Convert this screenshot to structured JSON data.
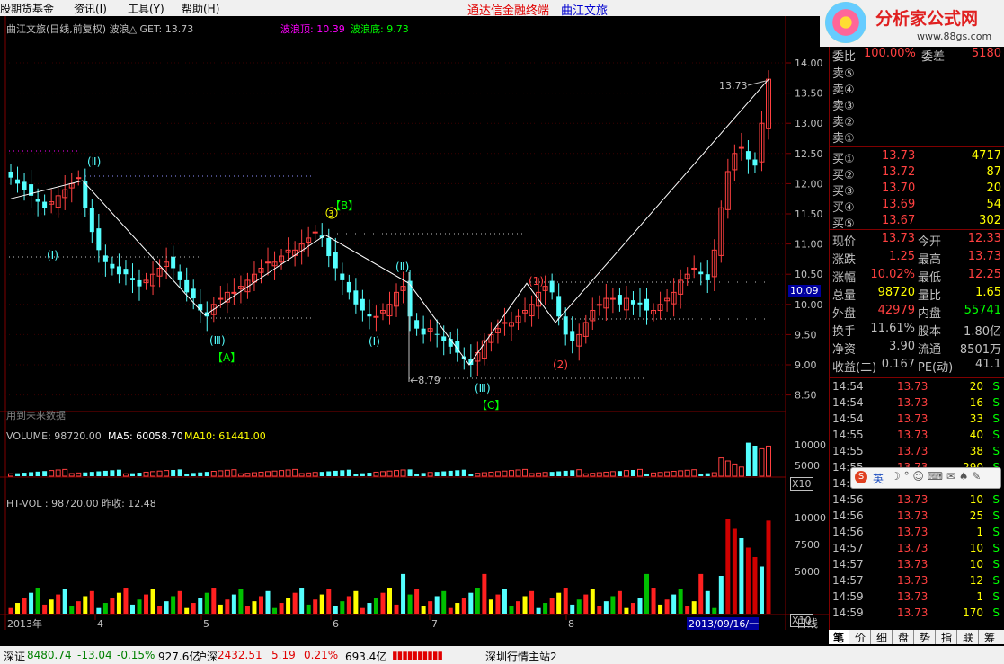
{
  "menu": {
    "items": [
      "股期货基金",
      "资讯(I)",
      "工具(Y)",
      "帮助(H)"
    ],
    "app_title": "通达信金融终端",
    "stock_name": "曲江文旅"
  },
  "logo": {
    "brand": "分析家公式网",
    "url": "www.88gs.com"
  },
  "chart": {
    "header": "曲江文旅(日线,前复权) 波浪△  GET: 13.73",
    "wave_top": "波浪顶: 10.39",
    "wave_bottom": "波浪底: 9.73",
    "future_note": "用到未来数据",
    "volume_title": "VOLUME: 98720.00",
    "ma5": "MA5: 60058.70",
    "ma10": "MA10: 61441.00",
    "htvol_title": "HT-VOL : 98720.00  昨收: 12.48",
    "current_price_tag": "10.09",
    "x10_label": "X10",
    "price_axis": [
      "14.00",
      "13.50",
      "13.00",
      "12.50",
      "12.00",
      "11.50",
      "11.00",
      "10.50",
      "10.00",
      "9.50",
      "9.00",
      "8.50"
    ],
    "vol_axis": [
      "10000",
      "5000"
    ],
    "htvol_axis": [
      "10000",
      "7500",
      "5000"
    ],
    "x_axis": [
      "2013年",
      "4",
      "5",
      "6",
      "7",
      "8"
    ],
    "date_marker": "2013/09/16/一",
    "period": "日线",
    "annotations": {
      "high_label": "13.73",
      "low_label": "8.79",
      "wave_I_left": "(Ⅰ)",
      "wave_II_left": "(Ⅱ)",
      "wave_III_left": "(Ⅲ)",
      "A": "【A】",
      "B": "【B】",
      "B_circle": "3",
      "wave_II_mid": "(Ⅱ)",
      "wave_I_mid": "(Ⅰ)",
      "wave_III_mid": "(Ⅲ)",
      "C": "【C】",
      "wave_1": "(1)",
      "wave_2": "(2)"
    }
  },
  "quote": {
    "top_partial": {
      "l1": "委比",
      "v1": "100.00%",
      "l2": "委差",
      "v2": "5180"
    },
    "asks": [
      {
        "label": "卖⑤",
        "price": "",
        "vol": ""
      },
      {
        "label": "卖④",
        "price": "",
        "vol": ""
      },
      {
        "label": "卖③",
        "price": "",
        "vol": ""
      },
      {
        "label": "卖②",
        "price": "",
        "vol": ""
      },
      {
        "label": "卖①",
        "price": "",
        "vol": ""
      }
    ],
    "bids": [
      {
        "label": "买①",
        "price": "13.73",
        "vol": "4717"
      },
      {
        "label": "买②",
        "price": "13.72",
        "vol": "87"
      },
      {
        "label": "买③",
        "price": "13.70",
        "vol": "20"
      },
      {
        "label": "买④",
        "price": "13.69",
        "vol": "54"
      },
      {
        "label": "买⑤",
        "price": "13.67",
        "vol": "302"
      }
    ],
    "stats": [
      {
        "l1": "现价",
        "v1": "13.73",
        "l2": "今开",
        "v2": "12.33"
      },
      {
        "l1": "涨跌",
        "v1": "1.25",
        "l2": "最高",
        "v2": "13.73"
      },
      {
        "l1": "涨幅",
        "v1": "10.02%",
        "l2": "最低",
        "v2": "12.25"
      },
      {
        "l1": "总量",
        "v1": "98720",
        "l2": "量比",
        "v2": "1.65"
      },
      {
        "l1": "外盘",
        "v1": "42979",
        "l2": "内盘",
        "v2": "55741"
      },
      {
        "l1": "换手",
        "v1": "11.61%",
        "l2": "股本",
        "v2": "1.80亿"
      },
      {
        "l1": "净资",
        "v1": "3.90",
        "l2": "流通",
        "v2": "8501万"
      },
      {
        "l1": "收益(二)",
        "v1": "0.167",
        "l2": "PE(动)",
        "v2": "41.1"
      }
    ],
    "ticks": [
      {
        "t": "14:54",
        "p": "13.73",
        "v": "20",
        "s": "S"
      },
      {
        "t": "14:54",
        "p": "13.73",
        "v": "16",
        "s": "S"
      },
      {
        "t": "14:54",
        "p": "13.73",
        "v": "33",
        "s": "S"
      },
      {
        "t": "14:55",
        "p": "13.73",
        "v": "40",
        "s": "S"
      },
      {
        "t": "14:55",
        "p": "13.73",
        "v": "38",
        "s": "S"
      },
      {
        "t": "14:55",
        "p": "13.73",
        "v": "290",
        "s": "S"
      },
      {
        "t": "14:56",
        "p": "13.73",
        "v": "",
        "s": ""
      },
      {
        "t": "14:56",
        "p": "13.73",
        "v": "10",
        "s": "S"
      },
      {
        "t": "14:56",
        "p": "13.73",
        "v": "25",
        "s": "S"
      },
      {
        "t": "14:56",
        "p": "13.73",
        "v": "1",
        "s": "S"
      },
      {
        "t": "14:57",
        "p": "13.73",
        "v": "10",
        "s": "S"
      },
      {
        "t": "14:57",
        "p": "13.73",
        "v": "10",
        "s": "S"
      },
      {
        "t": "14:57",
        "p": "13.73",
        "v": "12",
        "s": "S"
      },
      {
        "t": "14:59",
        "p": "13.73",
        "v": "1",
        "s": "S"
      },
      {
        "t": "14:59",
        "p": "13.73",
        "v": "170",
        "s": "S"
      }
    ]
  },
  "tabs": [
    "笔",
    "价",
    "细",
    "盘",
    "势",
    "指",
    "联",
    "筹"
  ],
  "ime": {
    "label": "英"
  },
  "status": {
    "sz_name": "深证",
    "sz_val": "8480.74",
    "sz_chg": "-13.04",
    "sz_pct": "-0.15%",
    "sz_amt": "927.6亿",
    "hs_name": "沪深",
    "hs_val": "2432.51",
    "hs_chg": "5.19",
    "hs_pct": "0.21%",
    "hs_amt": "693.4亿",
    "server": "深圳行情主站2"
  },
  "colors": {
    "up": "#ff4040",
    "down": "#54ffff",
    "ma5": "#ffffff",
    "ma10": "#ffff00",
    "grid": "#800000",
    "purple": "#ff00ff",
    "green": "#00ff00"
  },
  "chart_data": {
    "type": "candlestick",
    "x_labels": [
      "2013年",
      "4",
      "5",
      "6",
      "7",
      "8"
    ],
    "price_ticks": [
      14.0,
      13.5,
      13.0,
      12.5,
      12.0,
      11.5,
      11.0,
      10.5,
      10.0,
      9.5,
      9.0,
      8.5
    ],
    "close_prices": [
      12.1,
      12.0,
      11.9,
      11.8,
      11.7,
      11.6,
      11.7,
      11.8,
      11.9,
      12.0,
      12.1,
      11.6,
      11.2,
      10.9,
      10.7,
      10.6,
      10.5,
      10.5,
      10.4,
      10.3,
      10.4,
      10.5,
      10.6,
      10.7,
      10.6,
      10.4,
      10.2,
      10.1,
      9.9,
      9.8,
      10.0,
      10.1,
      10.2,
      10.2,
      10.3,
      10.4,
      10.5,
      10.6,
      10.7,
      10.7,
      10.8,
      10.9,
      10.9,
      11.0,
      11.1,
      11.2,
      11.1,
      10.8,
      10.6,
      10.4,
      10.2,
      10.0,
      9.9,
      9.8,
      9.8,
      9.9,
      10.0,
      10.2,
      10.3,
      9.8,
      9.6,
      9.5,
      9.6,
      9.5,
      9.4,
      9.3,
      9.2,
      9.1,
      9.0,
      9.2,
      9.4,
      9.5,
      9.6,
      9.7,
      9.7,
      9.8,
      9.9,
      10.0,
      10.2,
      10.3,
      10.2,
      9.8,
      9.5,
      9.4,
      9.5,
      9.7,
      9.9,
      10.0,
      10.1,
      10.1,
      10.0,
      10.1,
      10.0,
      10.0,
      9.9,
      9.9,
      10.0,
      10.1,
      10.2,
      10.4,
      10.5,
      10.6,
      10.5,
      10.4,
      10.9,
      11.6,
      12.2,
      12.5,
      12.6,
      12.4,
      12.3,
      13.0,
      13.73
    ],
    "volume_axis": [
      10000,
      5000
    ],
    "htvol_axis": [
      10000,
      7500,
      5000
    ]
  }
}
